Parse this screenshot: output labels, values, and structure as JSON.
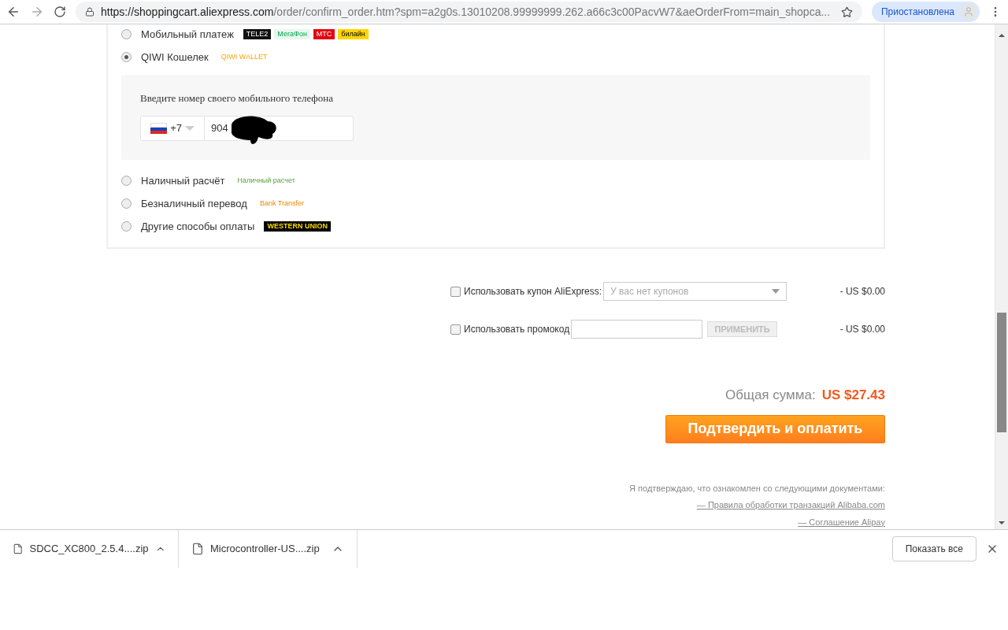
{
  "browser": {
    "url_host": "https://shoppingcart.aliexpress.com",
    "url_path": "/order/confirm_order.htm?spm=a2g0s.13010208.99999999.262.a66c3c00PacvW7&aeOrderFrom=main_shopca...",
    "profile_status": "Приостановлена"
  },
  "payment_methods": [
    {
      "label": "Мобильный платеж",
      "selected": false,
      "logos": [
        "TELE2",
        "МегаФон",
        "МТС",
        "билайн"
      ]
    },
    {
      "label": "QIWI Кошелек",
      "selected": true,
      "logos": [
        "QIWI WALLET"
      ]
    },
    {
      "label": "Наличный расчёт",
      "selected": false,
      "logos": [
        "Наличный расчет"
      ]
    },
    {
      "label": "Безналичный перевод",
      "selected": false,
      "logos": [
        "Bank Transfer"
      ]
    },
    {
      "label": "Другие способы оплаты",
      "selected": false,
      "logos": [
        "WESTERN UNION"
      ]
    }
  ],
  "phone_panel": {
    "prompt": "Введите номер своего мобильного телефона",
    "country_code": "+7",
    "number": "904"
  },
  "coupon": {
    "label": "Использовать купон AliExpress:",
    "checked": false,
    "placeholder": "У вас нет купонов",
    "amount": "- US $0.00"
  },
  "promo": {
    "label": "Использовать промокод",
    "checked": false,
    "apply": "ПРИМЕНИТЬ",
    "amount": "- US $0.00"
  },
  "total": {
    "label": "Общая сумма:",
    "value": "US $27.43"
  },
  "confirm_button": "Подтвердить и оплатить",
  "agreement": {
    "text": "Я подтверждаю, что ознакомлен со следующими документами:",
    "links": [
      "— Правила обработки транзакций Alibaba.com",
      "— Соглашение Alipay"
    ]
  },
  "downloads": [
    {
      "name": "SDCC_XC800_2.5.4....zip"
    },
    {
      "name": "Microcontroller-US....zip"
    }
  ],
  "show_all": "Показать все"
}
